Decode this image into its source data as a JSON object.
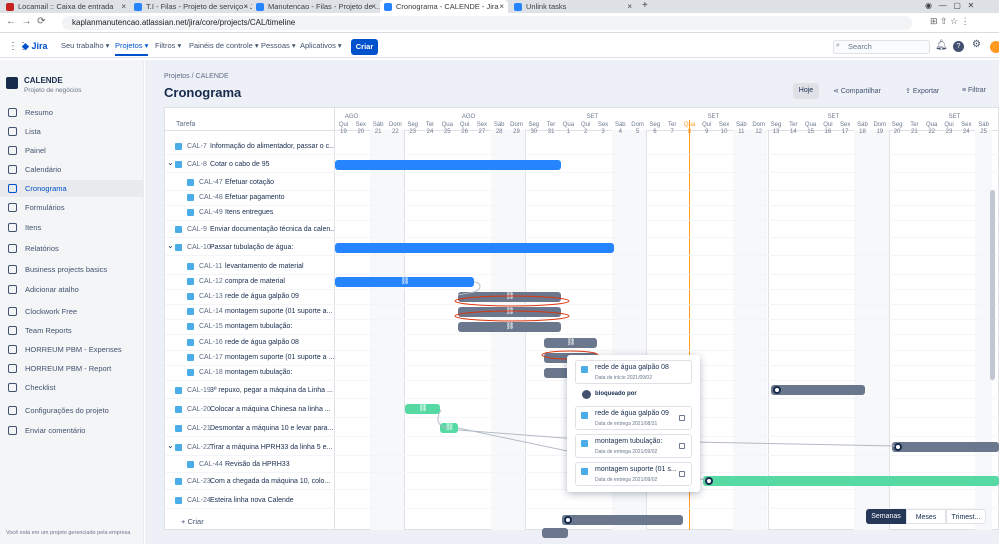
{
  "browser": {
    "tabs": [
      {
        "label": "Locamail :: Caixa de entrada",
        "color": "#c5221f"
      },
      {
        "label": "T.I - Filas - Projeto de serviço - Jir",
        "color": "#2684ff"
      },
      {
        "label": "Manutencao - Filas - Projeto de ...",
        "color": "#2684ff"
      },
      {
        "label": "Cronograma - CALENDE - Jira",
        "color": "#2684ff"
      },
      {
        "label": "Unlink tasks",
        "color": "#2684ff"
      }
    ],
    "url": "kaplanmanutencao.atlassian.net/jira/core/projects/CAL/timeline"
  },
  "topnav": {
    "logo": "Jira",
    "items": [
      "Seu trabalho ▾",
      "Projetos ▾",
      "Filtros ▾",
      "Painéis de controle ▾",
      "Pessoas ▾",
      "Aplicativos ▾"
    ],
    "create": "Criar",
    "search_placeholder": "Search"
  },
  "sidebar": {
    "project_name": "CALENDE",
    "project_type": "Projeto de negócios",
    "items": [
      "Resumo",
      "Lista",
      "Painel",
      "Calendário",
      "Cronograma",
      "Formulários",
      "Itens",
      "Relatórios",
      "Business projects basics",
      "Adicionar atalho",
      "Clockwork Free",
      "Team Reports",
      "HORREUM PBM - Expenses",
      "HORREUM PBM - Report",
      "Checklist",
      "Configurações do projeto",
      "Enviar comentário"
    ],
    "selected": "Cronograma",
    "footer": "Você está em um projeto gerenciado pela empresa"
  },
  "page": {
    "breadcrumb_root": "Projetos",
    "breadcrumb_sep": "/",
    "breadcrumb_project": "CALENDE",
    "title": "Cronograma",
    "today": "Hoje",
    "share": "Compartilhar",
    "export": "Exportar",
    "filter": "Filtrar",
    "task_col": "Tarefa",
    "add": "+ Criar"
  },
  "timeline": {
    "months": [
      {
        "label": "AGO"
      },
      {
        "label": "AGO"
      },
      {
        "label": "SET"
      },
      {
        "label": "SET"
      },
      {
        "label": "SET"
      },
      {
        "label": "SET"
      }
    ],
    "days": [
      [
        "Qui",
        "19"
      ],
      [
        "Sex",
        "20"
      ],
      [
        "Sáb",
        "21"
      ],
      [
        "Dom",
        "22"
      ],
      [
        "Seg",
        "23"
      ],
      [
        "Ter",
        "24"
      ],
      [
        "Qua",
        "25"
      ],
      [
        "Qui",
        "26"
      ],
      [
        "Sex",
        "27"
      ],
      [
        "Sáb",
        "28"
      ],
      [
        "Dom",
        "29"
      ],
      [
        "Seg",
        "30"
      ],
      [
        "Ter",
        "31"
      ],
      [
        "Qua",
        "1"
      ],
      [
        "Qui",
        "2"
      ],
      [
        "Sex",
        "3"
      ],
      [
        "Sáb",
        "4"
      ],
      [
        "Dom",
        "5"
      ],
      [
        "Seg",
        "6"
      ],
      [
        "Ter",
        "7"
      ],
      [
        "Qua",
        "8"
      ],
      [
        "Qui",
        "9"
      ],
      [
        "Sex",
        "10"
      ],
      [
        "Sáb",
        "11"
      ],
      [
        "Dom",
        "12"
      ],
      [
        "Seg",
        "13"
      ],
      [
        "Ter",
        "14"
      ],
      [
        "Qua",
        "15"
      ],
      [
        "Qui",
        "16"
      ],
      [
        "Sex",
        "17"
      ],
      [
        "Sáb",
        "18"
      ],
      [
        "Dom",
        "19"
      ],
      [
        "Seg",
        "20"
      ],
      [
        "Ter",
        "21"
      ],
      [
        "Qua",
        "22"
      ],
      [
        "Qui",
        "23"
      ],
      [
        "Sex",
        "24"
      ],
      [
        "Sáb",
        "25"
      ]
    ],
    "today_day": "8"
  },
  "rows": [
    {
      "key": "CAL-7",
      "title": "Informação do alimentador, passar o c...",
      "expand": "",
      "sub": false
    },
    {
      "key": "CAL-8",
      "title": "Cotar o cabo de 95",
      "expand": "⌄",
      "sub": false
    },
    {
      "key": "CAL-47",
      "title": "Efetuar cotação",
      "expand": "",
      "sub": true
    },
    {
      "key": "CAL-48",
      "title": "Efetuar pagamento",
      "expand": "",
      "sub": true
    },
    {
      "key": "CAL-49",
      "title": "Itens entregues",
      "expand": "",
      "sub": true
    },
    {
      "key": "CAL-9",
      "title": "Enviar documentação técnica da calen...",
      "expand": "",
      "sub": false
    },
    {
      "key": "CAL-10",
      "title": "Passar tubulação de água:",
      "expand": "⌄",
      "sub": false
    },
    {
      "key": "CAL-11",
      "title": "levantamento de material",
      "expand": "",
      "sub": true
    },
    {
      "key": "CAL-12",
      "title": "compra de material",
      "expand": "",
      "sub": true
    },
    {
      "key": "CAL-13",
      "title": "rede de água galpão 09",
      "expand": "",
      "sub": true
    },
    {
      "key": "CAL-14",
      "title": "montagem suporte (01 suporte a...",
      "expand": "",
      "sub": true
    },
    {
      "key": "CAL-15",
      "title": "montagem tubulação:",
      "expand": "",
      "sub": true
    },
    {
      "key": "CAL-16",
      "title": "rede de água galpão 08",
      "expand": "",
      "sub": true
    },
    {
      "key": "CAL-17",
      "title": "montagem suporte (01 suporte a ...",
      "expand": "",
      "sub": true
    },
    {
      "key": "CAL-18",
      "title": "montagem tubulação:",
      "expand": "",
      "sub": true
    },
    {
      "key": "CAL-19",
      "title": "3º repuxo, pegar a máquina da Linha ...",
      "expand": "",
      "sub": false
    },
    {
      "key": "CAL-20",
      "title": "Colocar a máquina Chinesa na linha ...",
      "expand": "",
      "sub": false
    },
    {
      "key": "CAL-21",
      "title": "Desmontar a máquina 10 e levar para...",
      "expand": "",
      "sub": false
    },
    {
      "key": "CAL-22",
      "title": "Tirar a máquina HPRH33 da linha 5 e...",
      "expand": "⌄",
      "sub": false
    },
    {
      "key": "CAL-44",
      "title": "Revisão da HPRH33",
      "expand": "",
      "sub": true
    },
    {
      "key": "CAL-23",
      "title": "Com a chegada da máquina 10, colo...",
      "expand": "",
      "sub": false
    },
    {
      "key": "CAL-24",
      "title": "Esteira linha nova Calende",
      "expand": "",
      "sub": false
    }
  ],
  "popup": {
    "top_item": {
      "title": "rede de água galpão 08",
      "sub": "Data de início 2021/09/02"
    },
    "blocked_label": "bloqueado por",
    "items": [
      {
        "title": "rede de água galpão 09",
        "sub": "Data de entrega 2021/08/31"
      },
      {
        "title": "montagem tubulação:",
        "sub": "Data de entrega 2021/09/02"
      },
      {
        "title": "montagem suporte (01 s...",
        "sub": "Data de entrega 2021/09/02"
      }
    ]
  },
  "zoom": {
    "options": [
      "Semanas",
      "Meses",
      "Trimest..."
    ],
    "selected": "Semanas"
  },
  "colors": {
    "accent": "#0052cc",
    "bar_blue": "#2684ff",
    "bar_gray": "#6b778c",
    "bar_green": "#57d9a3",
    "today_line": "#ff991f",
    "dependency": "#de350b"
  }
}
